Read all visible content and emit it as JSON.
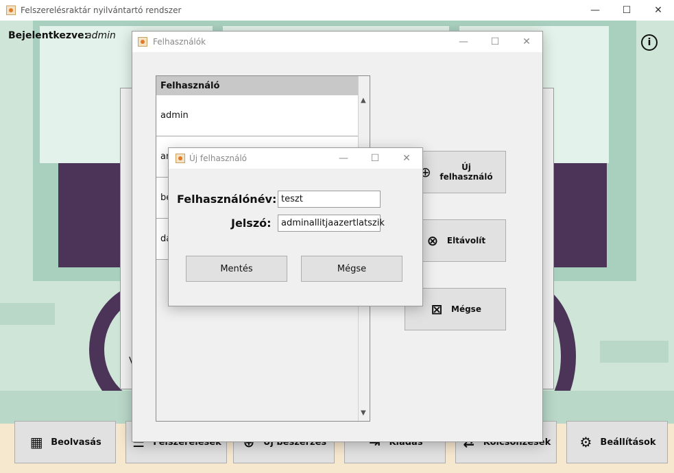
{
  "main_window": {
    "title": "Felszerelésraktár nyilvántartó rendszer",
    "minimize": "—",
    "maximize": "☐",
    "close": "✕",
    "logged_in_label": "Bejelentkezve:",
    "logged_in_user": "admin",
    "info_icon": "ⓘ"
  },
  "bottom_bar": {
    "buttons": [
      {
        "label": "Beolvasás",
        "icon": "qr-code-icon"
      },
      {
        "label": "Felszerelések",
        "icon": "list-icon"
      },
      {
        "label": "Új beszerzés",
        "icon": "add-list-icon"
      },
      {
        "label": "Kiadás",
        "icon": "dispense-icon"
      },
      {
        "label": "Kölcsönzések",
        "icon": "loan-icon"
      },
      {
        "label": "Beállítások",
        "icon": "gear-icon"
      }
    ]
  },
  "users_window": {
    "title": "Felhasználók",
    "minimize": "—",
    "maximize": "☐",
    "close": "✕",
    "table_header": "Felhasználó",
    "rows": [
      "admin",
      "an",
      "be",
      "da"
    ],
    "buttons": {
      "new_user_line1": "Új",
      "new_user_line2": "felhasználó",
      "remove": "Eltávolít",
      "cancel": "Mégse"
    }
  },
  "background_window": {
    "partial_label": "V"
  },
  "new_user_dialog": {
    "title": "Új felhasználó",
    "minimize": "—",
    "maximize": "☐",
    "close": "✕",
    "username_label": "Felhasználónév:",
    "username_value": "teszt",
    "password_label": "Jelszó:",
    "password_value": "adminallitjaazertlatszik",
    "save_button": "Mentés",
    "cancel_button": "Mégse"
  }
}
